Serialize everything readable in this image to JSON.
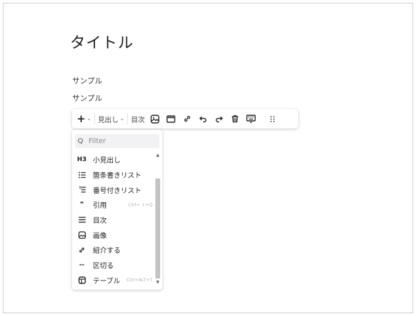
{
  "document": {
    "title": "タイトル",
    "paragraphs": [
      "サンプル",
      "サンプル"
    ]
  },
  "toolbar": {
    "add_label": "+",
    "heading_label": "見出し",
    "toc_label": "目次",
    "icons": [
      "image-icon",
      "video-icon",
      "link-icon",
      "undo-icon",
      "redo-icon",
      "trash-icon",
      "keyboard-icon",
      "drag-handle-icon"
    ]
  },
  "menu": {
    "filter_placeholder": "Filter",
    "items": [
      {
        "icon_text": "H3",
        "label": "小見出し",
        "shortcut": ""
      },
      {
        "icon_text": "",
        "label": "箇条書きリスト",
        "shortcut": ""
      },
      {
        "icon_text": "",
        "label": "番号付きリスト",
        "shortcut": ""
      },
      {
        "icon_text": "❞",
        "label": "引用",
        "shortcut": "Ctrl+ ⇧+Q"
      },
      {
        "icon_text": "",
        "label": "目次",
        "shortcut": ""
      },
      {
        "icon_text": "",
        "label": "画像",
        "shortcut": ""
      },
      {
        "icon_text": "",
        "label": "紹介する",
        "shortcut": ""
      },
      {
        "icon_text": "--",
        "label": "区切る",
        "shortcut": ""
      },
      {
        "icon_text": "",
        "label": "テーブル",
        "shortcut": "Ctrl+ALT+T"
      }
    ]
  }
}
